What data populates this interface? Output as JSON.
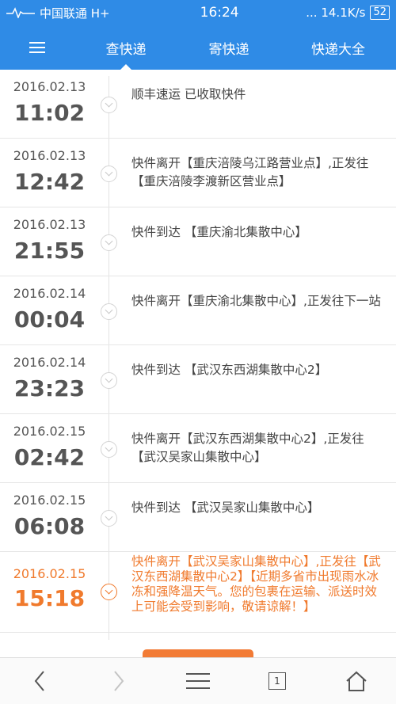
{
  "status_bar": {
    "carrier": "中国联通 H+",
    "time": "16:24",
    "speed": "... 14.1K/s",
    "battery": "52"
  },
  "nav": {
    "menu_icon": "menu-icon",
    "tabs": [
      {
        "label": "查快递",
        "active": true
      },
      {
        "label": "寄快递",
        "active": false
      },
      {
        "label": "快递大全",
        "active": false
      }
    ]
  },
  "timeline": [
    {
      "date": "2016.02.13",
      "time": "11:02",
      "text": "顺丰速运 已收取快件"
    },
    {
      "date": "2016.02.13",
      "time": "12:42",
      "text": "快件离开【重庆涪陵乌江路营业点】,正发往【重庆涪陵李渡新区营业点】"
    },
    {
      "date": "2016.02.13",
      "time": "21:55",
      "text": "快件到达 【重庆渝北集散中心】"
    },
    {
      "date": "2016.02.14",
      "time": "00:04",
      "text": "快件离开【重庆渝北集散中心】,正发往下一站"
    },
    {
      "date": "2016.02.14",
      "time": "23:23",
      "text": "快件到达 【武汉东西湖集散中心2】"
    },
    {
      "date": "2016.02.15",
      "time": "02:42",
      "text": "快件离开【武汉东西湖集散中心2】,正发往【武汉吴家山集散中心】"
    },
    {
      "date": "2016.02.15",
      "time": "06:08",
      "text": "快件到达 【武汉吴家山集散中心】"
    },
    {
      "date": "2016.02.15",
      "time": "15:18",
      "text": "快件离开【武汉吴家山集散中心】,正发往【武汉东西湖集散中心2】【近期多省市出现雨水冰冻和强降温天气。您的包裹在运输、派送时效上可能会受到影响，敬请谅解！】",
      "current": true
    }
  ],
  "bottom_bar": {
    "tab_count": "1",
    "icons": [
      "back-icon",
      "forward-icon",
      "menu-icon",
      "tabs-icon",
      "home-icon"
    ]
  },
  "colors": {
    "primary": "#2f8be6",
    "accent": "#f07a2d"
  }
}
